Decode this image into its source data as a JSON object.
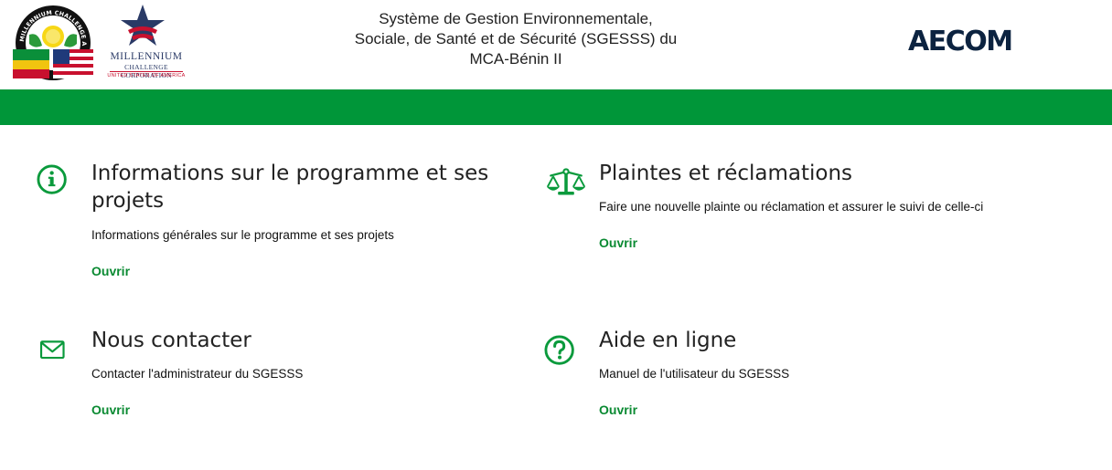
{
  "header": {
    "logo_mca_text": "MILLENNIUM CHALLENGE ACCOUNT BENIN II",
    "logo_mcc": {
      "line1": "MILLENNIUM",
      "line2": "CHALLENGE CORPORATION",
      "line3": "UNITED STATES OF AMERICA"
    },
    "title_lines": [
      "Système de Gestion Environnementale,",
      "Sociale, de Santé et de Sécurité (SGESSS) du",
      "MCA-Bénin II"
    ],
    "aecom_logo_text": "AECOM"
  },
  "colors": {
    "brand_green": "#009639",
    "link_green": "#0a8a32",
    "aecom_navy": "#0c2340"
  },
  "cards": [
    {
      "icon": "info-circle-icon",
      "title": "Informations sur le programme et ses projets",
      "description": "Informations générales sur le programme et ses projets",
      "link": "Ouvrir"
    },
    {
      "icon": "balance-scale-icon",
      "title": "Plaintes et réclamations",
      "description": "Faire une nouvelle plainte ou réclamation et assurer le suivi de celle-ci",
      "link": "Ouvrir"
    },
    {
      "icon": "envelope-icon",
      "title": "Nous contacter",
      "description": "Contacter l'administrateur du SGESSS",
      "link": "Ouvrir"
    },
    {
      "icon": "question-circle-icon",
      "title": "Aide en ligne",
      "description": "Manuel de l'utilisateur du SGESSS",
      "link": "Ouvrir"
    }
  ]
}
